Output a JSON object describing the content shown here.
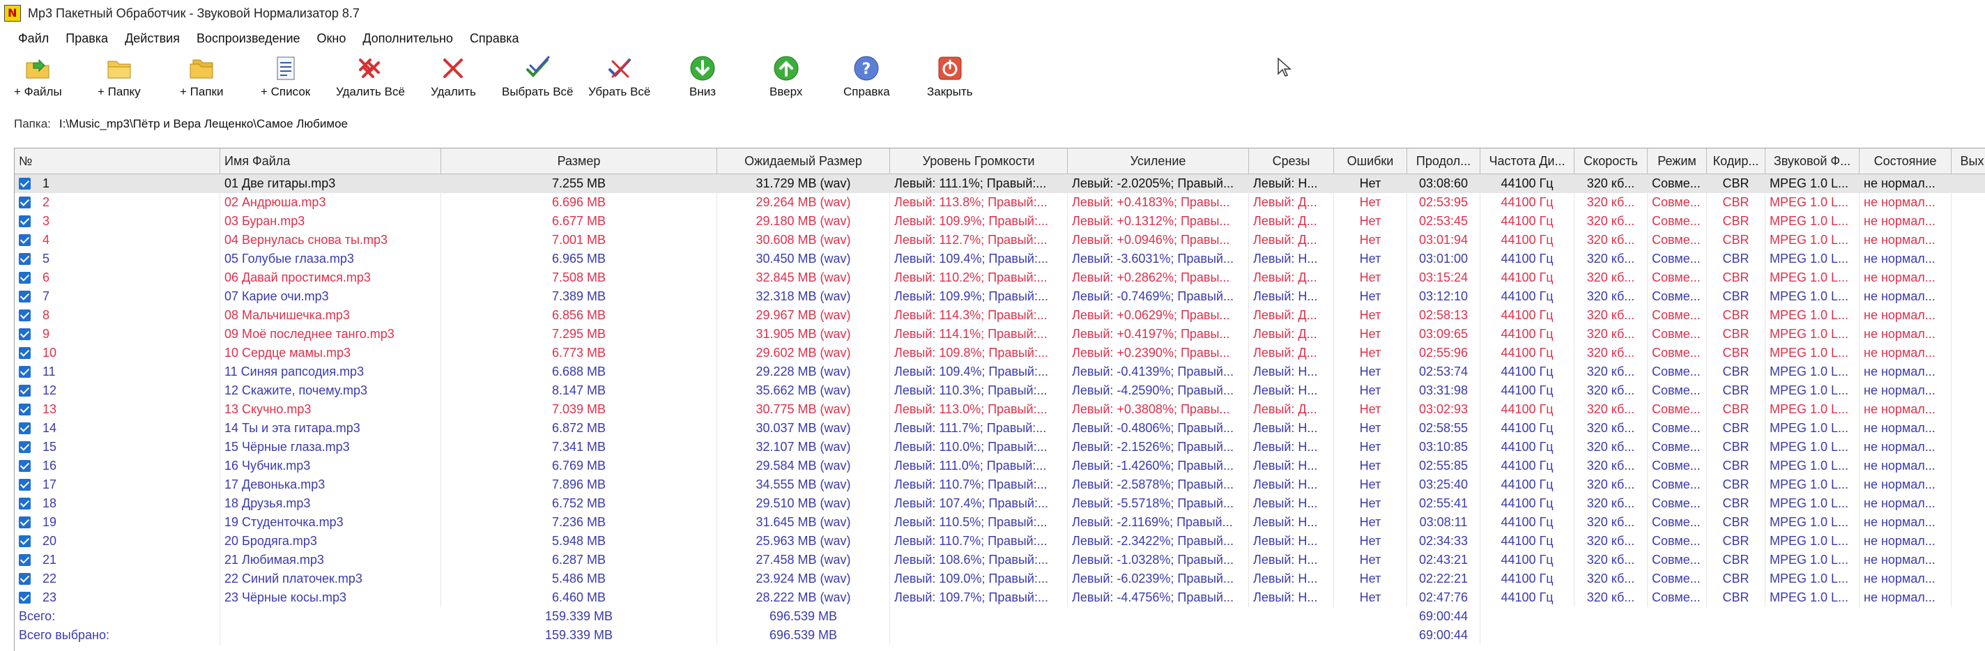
{
  "window": {
    "title": "Mp3 Пакетный Обработчик - Звуковой Нормализатор 8.7"
  },
  "menu": [
    "Файл",
    "Правка",
    "Действия",
    "Воспроизведение",
    "Окно",
    "Дополнительно",
    "Справка"
  ],
  "toolbar": {
    "add_files": "+ Файлы",
    "add_folder": "+ Папку",
    "add_folders": "+ Папки",
    "add_list": "+ Список",
    "delete_all": "Удалить Всё",
    "delete": "Удалить",
    "select_all": "Выбрать Всё",
    "deselect_all": "Убрать Всё",
    "down": "Вниз",
    "up": "Вверх",
    "help": "Справка",
    "close": "Закрыть"
  },
  "folder": {
    "label": "Папка:",
    "path": "I:\\Music_mp3\\Пётр и Вера Лещенко\\Самое Любимое"
  },
  "columns": [
    "№",
    "Имя Файла",
    "Размер",
    "Ожидаемый Размер",
    "Уровень Громкости",
    "Усиление",
    "Срезы",
    "Ошибки",
    "Продол...",
    "Частота Ди...",
    "Скорость",
    "Режим",
    "Кодир...",
    "Звуковой Ф...",
    "Состояние",
    "Вых"
  ],
  "colors": {
    "blue": "#3a3ab0",
    "red": "#e0304a",
    "selected_bg": "#e6e6e6"
  },
  "rows": [
    {
      "num": "1",
      "name": "01 Две гитары.mp3",
      "size": "7.255 MB",
      "exp": "31.729 MB (wav)",
      "vol": "Левый: 111.1%; Правый:...",
      "gain": "Левый: -2.0205%; Правый...",
      "clips": "Левый: Н...",
      "errors": "Нет",
      "dur": "03:08:60",
      "freq": "44100 Гц",
      "rate": "320 кб...",
      "mode": "Совме...",
      "enc": "CBR",
      "fmt": "MPEG 1.0 L...",
      "state": "не нормал...",
      "color": "black",
      "selected": true
    },
    {
      "num": "2",
      "name": "02 Андрюша.mp3",
      "size": "6.696 MB",
      "exp": "29.264 MB (wav)",
      "vol": "Левый: 113.8%; Правый:...",
      "gain": "Левый: +0.4183%; Правы...",
      "clips": "Левый: Д...",
      "errors": "Нет",
      "dur": "02:53:95",
      "freq": "44100 Гц",
      "rate": "320 кб...",
      "mode": "Совме...",
      "enc": "CBR",
      "fmt": "MPEG 1.0 L...",
      "state": "не нормал...",
      "color": "red",
      "selected": false
    },
    {
      "num": "3",
      "name": "03 Буран.mp3",
      "size": "6.677 MB",
      "exp": "29.180 MB (wav)",
      "vol": "Левый: 109.9%; Правый:...",
      "gain": "Левый: +0.1312%; Правы...",
      "clips": "Левый: Д...",
      "errors": "Нет",
      "dur": "02:53:45",
      "freq": "44100 Гц",
      "rate": "320 кб...",
      "mode": "Совме...",
      "enc": "CBR",
      "fmt": "MPEG 1.0 L...",
      "state": "не нормал...",
      "color": "red",
      "selected": false
    },
    {
      "num": "4",
      "name": "04 Вернулась снова ты.mp3",
      "size": "7.001 MB",
      "exp": "30.608 MB (wav)",
      "vol": "Левый: 112.7%; Правый:...",
      "gain": "Левый: +0.0946%; Правы...",
      "clips": "Левый: Д...",
      "errors": "Нет",
      "dur": "03:01:94",
      "freq": "44100 Гц",
      "rate": "320 кб...",
      "mode": "Совме...",
      "enc": "CBR",
      "fmt": "MPEG 1.0 L...",
      "state": "не нормал...",
      "color": "red",
      "selected": false
    },
    {
      "num": "5",
      "name": "05 Голубые глаза.mp3",
      "size": "6.965 MB",
      "exp": "30.450 MB (wav)",
      "vol": "Левый: 109.4%; Правый:...",
      "gain": "Левый: -3.6031%; Правый...",
      "clips": "Левый: Н...",
      "errors": "Нет",
      "dur": "03:01:00",
      "freq": "44100 Гц",
      "rate": "320 кб...",
      "mode": "Совме...",
      "enc": "CBR",
      "fmt": "MPEG 1.0 L...",
      "state": "не нормал...",
      "color": "blue",
      "selected": false
    },
    {
      "num": "6",
      "name": "06 Давай простимся.mp3",
      "size": "7.508 MB",
      "exp": "32.845 MB (wav)",
      "vol": "Левый: 110.2%; Правый:...",
      "gain": "Левый: +0.2862%; Правы...",
      "clips": "Левый: Д...",
      "errors": "Нет",
      "dur": "03:15:24",
      "freq": "44100 Гц",
      "rate": "320 кб...",
      "mode": "Совме...",
      "enc": "CBR",
      "fmt": "MPEG 1.0 L...",
      "state": "не нормал...",
      "color": "red",
      "selected": false
    },
    {
      "num": "7",
      "name": "07 Карие очи.mp3",
      "size": "7.389 MB",
      "exp": "32.318 MB (wav)",
      "vol": "Левый: 109.9%; Правый:...",
      "gain": "Левый: -0.7469%; Правый...",
      "clips": "Левый: Н...",
      "errors": "Нет",
      "dur": "03:12:10",
      "freq": "44100 Гц",
      "rate": "320 кб...",
      "mode": "Совме...",
      "enc": "CBR",
      "fmt": "MPEG 1.0 L...",
      "state": "не нормал...",
      "color": "blue",
      "selected": false
    },
    {
      "num": "8",
      "name": "08 Мальчишечка.mp3",
      "size": "6.856 MB",
      "exp": "29.967 MB (wav)",
      "vol": "Левый: 114.3%; Правый:...",
      "gain": "Левый: +0.0629%; Правы...",
      "clips": "Левый: Д...",
      "errors": "Нет",
      "dur": "02:58:13",
      "freq": "44100 Гц",
      "rate": "320 кб...",
      "mode": "Совме...",
      "enc": "CBR",
      "fmt": "MPEG 1.0 L...",
      "state": "не нормал...",
      "color": "red",
      "selected": false
    },
    {
      "num": "9",
      "name": "09 Моё последнее танго.mp3",
      "size": "7.295 MB",
      "exp": "31.905 MB (wav)",
      "vol": "Левый: 114.1%; Правый:...",
      "gain": "Левый: +0.4197%; Правы...",
      "clips": "Левый: Д...",
      "errors": "Нет",
      "dur": "03:09:65",
      "freq": "44100 Гц",
      "rate": "320 кб...",
      "mode": "Совме...",
      "enc": "CBR",
      "fmt": "MPEG 1.0 L...",
      "state": "не нормал...",
      "color": "red",
      "selected": false
    },
    {
      "num": "10",
      "name": "10 Сердце мамы.mp3",
      "size": "6.773 MB",
      "exp": "29.602 MB (wav)",
      "vol": "Левый: 109.8%; Правый:...",
      "gain": "Левый: +0.2390%; Правы...",
      "clips": "Левый: Д...",
      "errors": "Нет",
      "dur": "02:55:96",
      "freq": "44100 Гц",
      "rate": "320 кб...",
      "mode": "Совме...",
      "enc": "CBR",
      "fmt": "MPEG 1.0 L...",
      "state": "не нормал...",
      "color": "red",
      "selected": false
    },
    {
      "num": "11",
      "name": "11 Синяя рапсодия.mp3",
      "size": "6.688 MB",
      "exp": "29.228 MB (wav)",
      "vol": "Левый: 109.4%; Правый:...",
      "gain": "Левый: -0.4139%; Правый...",
      "clips": "Левый: Н...",
      "errors": "Нет",
      "dur": "02:53:74",
      "freq": "44100 Гц",
      "rate": "320 кб...",
      "mode": "Совме...",
      "enc": "CBR",
      "fmt": "MPEG 1.0 L...",
      "state": "не нормал...",
      "color": "blue",
      "selected": false
    },
    {
      "num": "12",
      "name": "12 Скажите, почему.mp3",
      "size": "8.147 MB",
      "exp": "35.662 MB (wav)",
      "vol": "Левый: 110.3%; Правый:...",
      "gain": "Левый: -4.2590%; Правый...",
      "clips": "Левый: Н...",
      "errors": "Нет",
      "dur": "03:31:98",
      "freq": "44100 Гц",
      "rate": "320 кб...",
      "mode": "Совме...",
      "enc": "CBR",
      "fmt": "MPEG 1.0 L...",
      "state": "не нормал...",
      "color": "blue",
      "selected": false
    },
    {
      "num": "13",
      "name": "13 Скучно.mp3",
      "size": "7.039 MB",
      "exp": "30.775 MB (wav)",
      "vol": "Левый: 113.0%; Правый:...",
      "gain": "Левый: +0.3808%; Правы...",
      "clips": "Левый: Д...",
      "errors": "Нет",
      "dur": "03:02:93",
      "freq": "44100 Гц",
      "rate": "320 кб...",
      "mode": "Совме...",
      "enc": "CBR",
      "fmt": "MPEG 1.0 L...",
      "state": "не нормал...",
      "color": "red",
      "selected": false
    },
    {
      "num": "14",
      "name": "14 Ты и эта гитара.mp3",
      "size": "6.872 MB",
      "exp": "30.037 MB (wav)",
      "vol": "Левый: 111.7%; Правый:...",
      "gain": "Левый: -0.4806%; Правый...",
      "clips": "Левый: Н...",
      "errors": "Нет",
      "dur": "02:58:55",
      "freq": "44100 Гц",
      "rate": "320 кб...",
      "mode": "Совме...",
      "enc": "CBR",
      "fmt": "MPEG 1.0 L...",
      "state": "не нормал...",
      "color": "blue",
      "selected": false
    },
    {
      "num": "15",
      "name": "15 Чёрные глаза.mp3",
      "size": "7.341 MB",
      "exp": "32.107 MB (wav)",
      "vol": "Левый: 110.0%; Правый:...",
      "gain": "Левый: -2.1526%; Правый...",
      "clips": "Левый: Н...",
      "errors": "Нет",
      "dur": "03:10:85",
      "freq": "44100 Гц",
      "rate": "320 кб...",
      "mode": "Совме...",
      "enc": "CBR",
      "fmt": "MPEG 1.0 L...",
      "state": "не нормал...",
      "color": "blue",
      "selected": false
    },
    {
      "num": "16",
      "name": "16 Чубчик.mp3",
      "size": "6.769 MB",
      "exp": "29.584 MB (wav)",
      "vol": "Левый: 111.0%; Правый:...",
      "gain": "Левый: -1.4260%; Правый...",
      "clips": "Левый: Н...",
      "errors": "Нет",
      "dur": "02:55:85",
      "freq": "44100 Гц",
      "rate": "320 кб...",
      "mode": "Совме...",
      "enc": "CBR",
      "fmt": "MPEG 1.0 L...",
      "state": "не нормал...",
      "color": "blue",
      "selected": false
    },
    {
      "num": "17",
      "name": "17 Девонька.mp3",
      "size": "7.896 MB",
      "exp": "34.555 MB (wav)",
      "vol": "Левый: 110.7%; Правый:...",
      "gain": "Левый: -2.5878%; Правый...",
      "clips": "Левый: Н...",
      "errors": "Нет",
      "dur": "03:25:40",
      "freq": "44100 Гц",
      "rate": "320 кб...",
      "mode": "Совме...",
      "enc": "CBR",
      "fmt": "MPEG 1.0 L...",
      "state": "не нормал...",
      "color": "blue",
      "selected": false
    },
    {
      "num": "18",
      "name": "18 Друзья.mp3",
      "size": "6.752 MB",
      "exp": "29.510 MB (wav)",
      "vol": "Левый: 107.4%; Правый:...",
      "gain": "Левый: -5.5718%; Правый...",
      "clips": "Левый: Н...",
      "errors": "Нет",
      "dur": "02:55:41",
      "freq": "44100 Гц",
      "rate": "320 кб...",
      "mode": "Совме...",
      "enc": "CBR",
      "fmt": "MPEG 1.0 L...",
      "state": "не нормал...",
      "color": "blue",
      "selected": false
    },
    {
      "num": "19",
      "name": "19 Студенточка.mp3",
      "size": "7.236 MB",
      "exp": "31.645 MB (wav)",
      "vol": "Левый: 110.5%; Правый:...",
      "gain": "Левый: -2.1169%; Правый...",
      "clips": "Левый: Н...",
      "errors": "Нет",
      "dur": "03:08:11",
      "freq": "44100 Гц",
      "rate": "320 кб...",
      "mode": "Совме...",
      "enc": "CBR",
      "fmt": "MPEG 1.0 L...",
      "state": "не нормал...",
      "color": "blue",
      "selected": false
    },
    {
      "num": "20",
      "name": "20 Бродяга.mp3",
      "size": "5.948 MB",
      "exp": "25.963 MB (wav)",
      "vol": "Левый: 110.7%; Правый:...",
      "gain": "Левый: -2.3422%; Правый...",
      "clips": "Левый: Н...",
      "errors": "Нет",
      "dur": "02:34:33",
      "freq": "44100 Гц",
      "rate": "320 кб...",
      "mode": "Совме...",
      "enc": "CBR",
      "fmt": "MPEG 1.0 L...",
      "state": "не нормал...",
      "color": "blue",
      "selected": false
    },
    {
      "num": "21",
      "name": "21 Любимая.mp3",
      "size": "6.287 MB",
      "exp": "27.458 MB (wav)",
      "vol": "Левый: 108.6%; Правый:...",
      "gain": "Левый: -1.0328%; Правый...",
      "clips": "Левый: Н...",
      "errors": "Нет",
      "dur": "02:43:21",
      "freq": "44100 Гц",
      "rate": "320 кб...",
      "mode": "Совме...",
      "enc": "CBR",
      "fmt": "MPEG 1.0 L...",
      "state": "не нормал...",
      "color": "blue",
      "selected": false
    },
    {
      "num": "22",
      "name": "22 Синий платочек.mp3",
      "size": "5.486 MB",
      "exp": "23.924 MB (wav)",
      "vol": "Левый: 109.0%; Правый:...",
      "gain": "Левый: -6.0239%; Правый...",
      "clips": "Левый: Н...",
      "errors": "Нет",
      "dur": "02:22:21",
      "freq": "44100 Гц",
      "rate": "320 кб...",
      "mode": "Совме...",
      "enc": "CBR",
      "fmt": "MPEG 1.0 L...",
      "state": "не нормал...",
      "color": "blue",
      "selected": false
    },
    {
      "num": "23",
      "name": "23 Чёрные косы.mp3",
      "size": "6.460 MB",
      "exp": "28.222 MB (wav)",
      "vol": "Левый: 109.7%; Правый:...",
      "gain": "Левый: -4.4756%; Правый...",
      "clips": "Левый: Н...",
      "errors": "Нет",
      "dur": "02:47:76",
      "freq": "44100 Гц",
      "rate": "320 кб...",
      "mode": "Совме...",
      "enc": "CBR",
      "fmt": "MPEG 1.0 L...",
      "state": "не нормал...",
      "color": "blue",
      "selected": false
    }
  ],
  "totals": [
    {
      "label": "Всего:",
      "size": "159.339 MB",
      "exp": "696.539 MB",
      "dur": "69:00:44"
    },
    {
      "label": "Всего выбрано:",
      "size": "159.339 MB",
      "exp": "696.539 MB",
      "dur": "69:00:44"
    }
  ]
}
